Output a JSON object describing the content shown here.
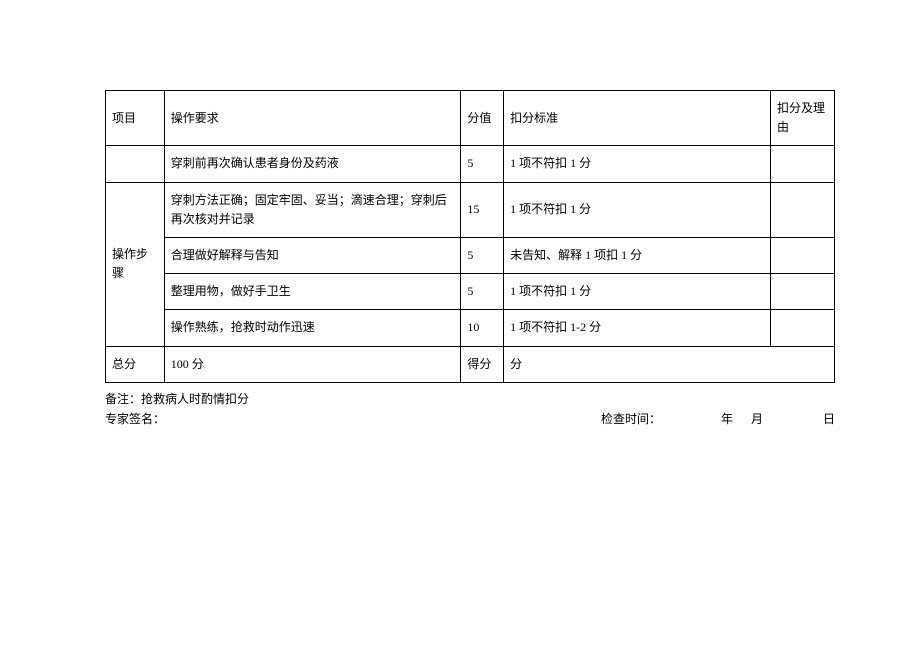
{
  "header": {
    "project": "项目",
    "requirement": "操作要求",
    "score": "分值",
    "standard": "扣分标准",
    "reason": "扣分及理由"
  },
  "project_label": "操作步骤",
  "rows": [
    {
      "req": "穿刺前再次确认患者身份及药液",
      "score": "5",
      "std": "1 项不符扣 1 分"
    },
    {
      "req": "穿刺方法正确；固定牢固、妥当；滴速合理；穿刺后再次核对并记录",
      "score": "15",
      "std": "1 项不符扣 1 分"
    },
    {
      "req": "合理做好解释与告知",
      "score": "5",
      "std": "未告知、解释 1 项扣 1 分"
    },
    {
      "req": "整理用物，做好手卫生",
      "score": "5",
      "std": "1 项不符扣 1 分"
    },
    {
      "req": "操作熟练，抢救时动作迅速",
      "score": "10",
      "std": "1 项不符扣 1-2 分"
    }
  ],
  "total_row": {
    "label": "总分",
    "total": "100 分",
    "score_label": "得分",
    "score_value": "分"
  },
  "footer": {
    "note": "备注：抢救病人时酌情扣分",
    "sign": "专家签名：",
    "check_label": "检查时间：",
    "year": "年",
    "month": "月",
    "day": "日"
  }
}
